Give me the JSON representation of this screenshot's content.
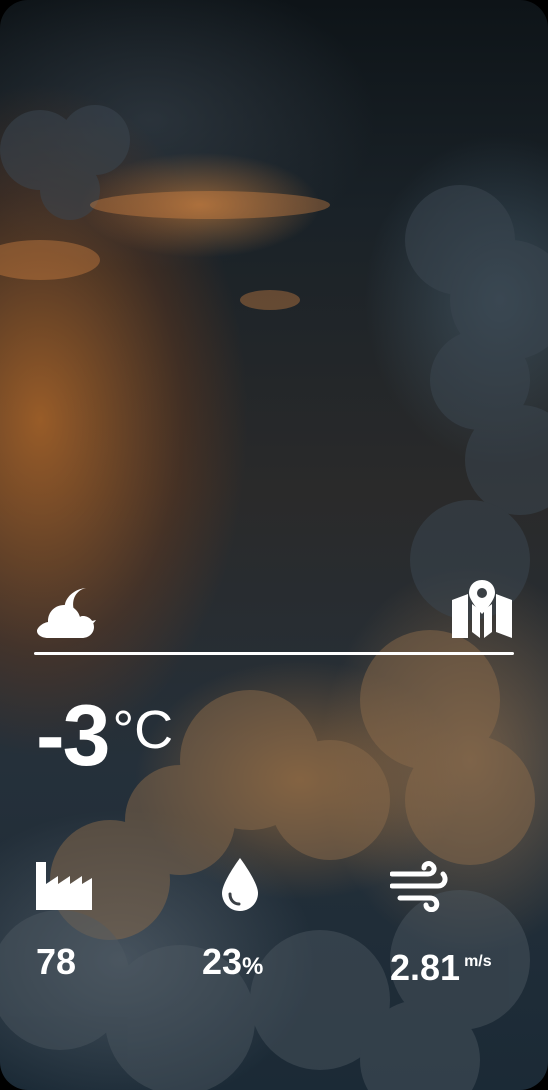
{
  "weather": {
    "condition_icon": "cloud-moon-icon",
    "map_icon": "map-location-icon",
    "temperature": {
      "value": "-3",
      "unit": "°C"
    },
    "stats": {
      "air_quality": {
        "icon": "factory-icon",
        "value": "78"
      },
      "humidity": {
        "icon": "water-drop-icon",
        "value": "23",
        "unit": "%"
      },
      "wind": {
        "icon": "wind-icon",
        "value": "2.81",
        "unit": "m/s"
      }
    }
  },
  "colors": {
    "text": "#ffffff",
    "accent_orange": "#d67828",
    "sky_dark": "#1b2a36"
  }
}
